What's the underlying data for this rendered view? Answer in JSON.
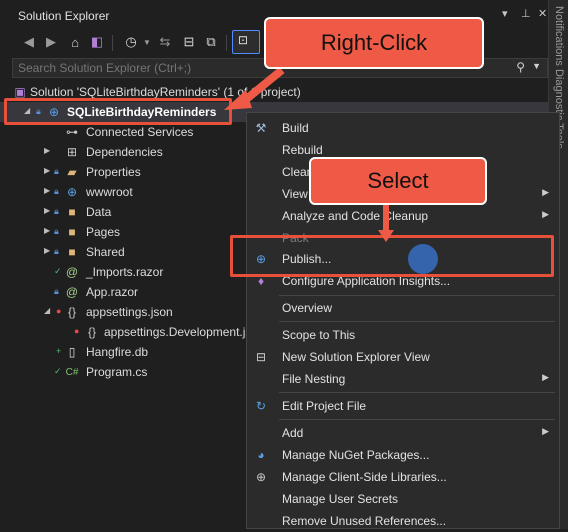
{
  "window": {
    "title": "Solution Explorer",
    "controls": [
      "▾",
      "⊥",
      "✕"
    ],
    "side_tab": "Notifications  Diagnostic Tools"
  },
  "search": {
    "placeholder": "Search Solution Explorer (Ctrl+;)"
  },
  "tree": {
    "solution": "Solution 'SQLiteBirthdayReminders' (1 of 1 project)",
    "project": "SQLiteBirthdayReminders",
    "items": [
      {
        "label": "Connected Services",
        "icon": "connected-services-icon"
      },
      {
        "label": "Dependencies",
        "icon": "dependencies-icon"
      },
      {
        "label": "Properties",
        "icon": "properties-icon"
      },
      {
        "label": "wwwroot",
        "icon": "globe-icon"
      },
      {
        "label": "Data",
        "icon": "folder-icon"
      },
      {
        "label": "Pages",
        "icon": "folder-icon"
      },
      {
        "label": "Shared",
        "icon": "folder-icon"
      },
      {
        "label": "_Imports.razor",
        "icon": "razor-file-icon"
      },
      {
        "label": "App.razor",
        "icon": "razor-file-icon"
      },
      {
        "label": "appsettings.json",
        "icon": "json-file-icon"
      },
      {
        "label": "appsettings.Development.json",
        "icon": "json-file-icon"
      },
      {
        "label": "Hangfire.db",
        "icon": "db-file-icon"
      },
      {
        "label": "Program.cs",
        "icon": "csharp-file-icon"
      }
    ]
  },
  "context_menu": {
    "items": [
      {
        "label": "Build",
        "icon": "build-icon"
      },
      {
        "label": "Rebuild"
      },
      {
        "label": "Clean"
      },
      {
        "label": "View",
        "submenu": true
      },
      {
        "label": "Analyze and Code Cleanup",
        "submenu": true
      },
      {
        "label": "Pack",
        "disabled": true
      },
      {
        "label": "Publish...",
        "icon": "globe-icon"
      },
      {
        "label": "Configure Application Insights...",
        "icon": "lightbulb-icon"
      },
      {
        "label": "Overview"
      },
      {
        "label": "Scope to This"
      },
      {
        "label": "New Solution Explorer View",
        "icon": "new-view-icon"
      },
      {
        "label": "File Nesting",
        "submenu": true
      },
      {
        "label": "Edit Project File",
        "icon": "refresh-icon"
      },
      {
        "label": "Add",
        "submenu": true
      },
      {
        "label": "Manage NuGet Packages...",
        "icon": "nuget-icon"
      },
      {
        "label": "Manage Client-Side Libraries...",
        "icon": "libraries-icon"
      },
      {
        "label": "Manage User Secrets"
      },
      {
        "label": "Remove Unused References..."
      }
    ]
  },
  "callouts": {
    "right_click": "Right-Click",
    "select": "Select"
  },
  "colors": {
    "accent": "#ee5a45",
    "highlight_border": "#e8503a",
    "selection": "#37373d",
    "cursor": "#3a77d8"
  }
}
